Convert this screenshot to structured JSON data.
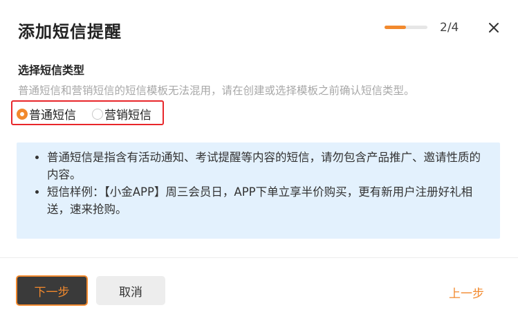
{
  "dialog": {
    "title": "添加短信提醒",
    "step_text": "2/4",
    "progress_fraction": 0.5,
    "close_icon": "close-icon"
  },
  "sms_type": {
    "section_title": "选择短信类型",
    "hint": "普通短信和营销短信的短信模板无法混用，请在创建或选择模板之前确认短信类型。",
    "options": [
      {
        "label": "普通短信",
        "checked": true
      },
      {
        "label": "营销短信",
        "checked": false
      }
    ]
  },
  "info": {
    "items": [
      "普通短信是指含有活动通知、考试提醒等内容的短信，请勿包含产品推广、邀请性质的内容。",
      "短信样例：【小金APP】周三会员日，APP下单立享半价购买，更有新用户注册好礼相送，速来抢购。"
    ]
  },
  "footer": {
    "next_label": "下一步",
    "cancel_label": "取消",
    "prev_label": "上一步"
  },
  "colors": {
    "accent": "#f2892d",
    "highlight_border": "#e8262a",
    "info_bg": "#e3f1fd"
  }
}
